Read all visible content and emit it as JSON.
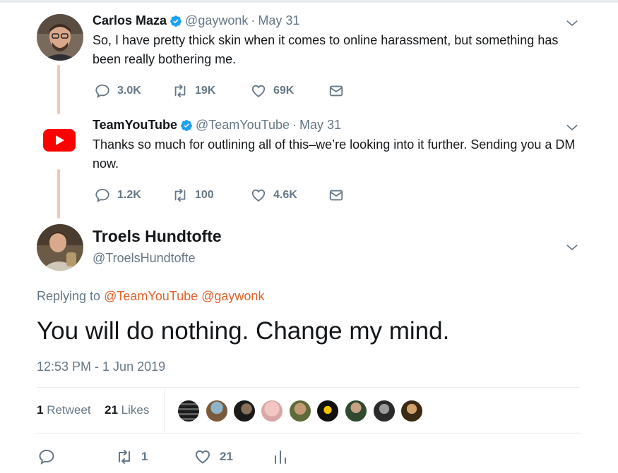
{
  "tweets": [
    {
      "name": "Carlos Maza",
      "handle": "@gaywonk",
      "separator": "·",
      "date": "May 31",
      "text": "So, I have pretty thick skin when it comes to online harassment, but something has been really bothering me.",
      "replies": "3.0K",
      "retweets": "19K",
      "likes": "69K"
    },
    {
      "name": "TeamYouTube",
      "handle": "@TeamYouTube",
      "separator": "·",
      "date": "May 31",
      "text": "Thanks so much for outlining all of this–we’re looking into it further. Sending you a DM now.",
      "replies": "1.2K",
      "retweets": "100",
      "likes": "4.6K"
    }
  ],
  "main_tweet": {
    "name": "Troels Hundtofte",
    "handle": "@TroelsHundtofte",
    "replying_prefix": "Replying to",
    "replying_mentions": [
      "@TeamYouTube",
      "@gaywonk"
    ],
    "text": "You will do nothing. Change my mind.",
    "timestamp": "12:53 PM - 1 Jun 2019",
    "retweet_count": "1",
    "retweet_label": "Retweet",
    "like_count": "21",
    "like_label": "Likes",
    "actions": {
      "retweets": "1",
      "likes": "21"
    }
  },
  "icons": {
    "reply": "reply-icon",
    "retweet": "retweet-icon",
    "like": "heart-icon",
    "message": "envelope-icon",
    "analytics": "analytics-icon",
    "verified": "verified-badge-icon",
    "caret": "chevron-down-icon"
  },
  "colors": {
    "text": "#14171a",
    "secondary": "#657786",
    "mention": "#e0622b",
    "verified": "#1da1f2",
    "youtube": "#ff0000",
    "thread_line": "#f4c7b5",
    "divider": "#e6ecf0"
  }
}
